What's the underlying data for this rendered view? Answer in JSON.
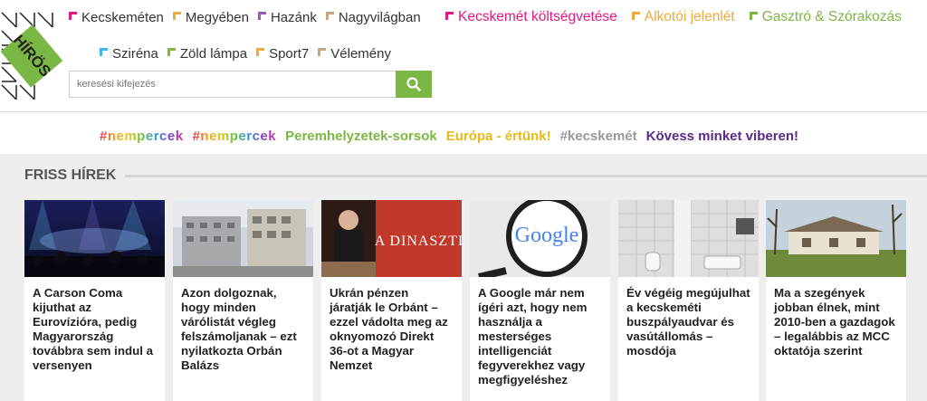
{
  "logo": {
    "text": "HÍRÖS"
  },
  "nav": {
    "row1": [
      {
        "label": "Kecskeméten",
        "color": "#e4197e"
      },
      {
        "label": "Megyében",
        "color": "#f0a93b"
      },
      {
        "label": "Hazánk",
        "color": "#9b59b6"
      },
      {
        "label": "Nagyvilágban",
        "color": "#c8a57e"
      }
    ],
    "row2": [
      {
        "label": "Sziréna",
        "color": "#3fb6e8"
      },
      {
        "label": "Zöld lámpa",
        "color": "#7bb744"
      },
      {
        "label": "Sport7",
        "color": "#f0a93b"
      },
      {
        "label": "Vélemény",
        "color": "#c8a57e"
      }
    ],
    "row3": [
      {
        "label": "Kecskemét költségvetése",
        "color": "#e4197e"
      },
      {
        "label": "Alkotói jelenlét",
        "color": "#f0a93b"
      },
      {
        "label": "Gasztró & Szórakozás",
        "color": "#7bb744"
      }
    ]
  },
  "search": {
    "placeholder": "keresési kifejezés",
    "icon": "search-icon"
  },
  "tags": [
    {
      "label": "#nempercek",
      "style": "rainbow"
    },
    {
      "label": "#nempercek",
      "style": "rainbow"
    },
    {
      "label": "Peremhelyzetek-sorsok",
      "color": "#7bb744"
    },
    {
      "label": "Európa - értünk!",
      "color": "#e9b81b"
    },
    {
      "label": "#kecskemét",
      "color": "#999999"
    },
    {
      "label": "Kövess minket viberen!",
      "color": "#5b2a86"
    }
  ],
  "section": {
    "title": "FRISS HÍREK"
  },
  "articles": [
    {
      "title": "A Carson Coma kijuthat az Eurovízióra, pedig Magyarország továbbra sem indul a versenyen"
    },
    {
      "title": "Azon dolgoznak, hogy minden várólistát végleg felszámoljanak – ezt nyilatkozta Orbán Balázs"
    },
    {
      "title": "Ukrán pénzen járatják le Orbánt – ezzel vádolta meg az oknyomozó Direkt 36-ot a Magyar Nemzet",
      "img_text": "A DINASZTI"
    },
    {
      "title": "A Google már nem ígéri azt, hogy nem használja a mesterséges intelligenciát fegyverekhez vagy megfigyeléshez",
      "img_text": "Google"
    },
    {
      "title": "Év végéig megújulhat a kecskeméti buszpályaudvar és vasútállomás – mosdója"
    },
    {
      "title": "Ma a szegények jobban élnek, mint 2010-ben a gazdagok – legalábbis az MCC oktatója szerint"
    }
  ],
  "colors": {
    "accent": "#7bb744"
  }
}
